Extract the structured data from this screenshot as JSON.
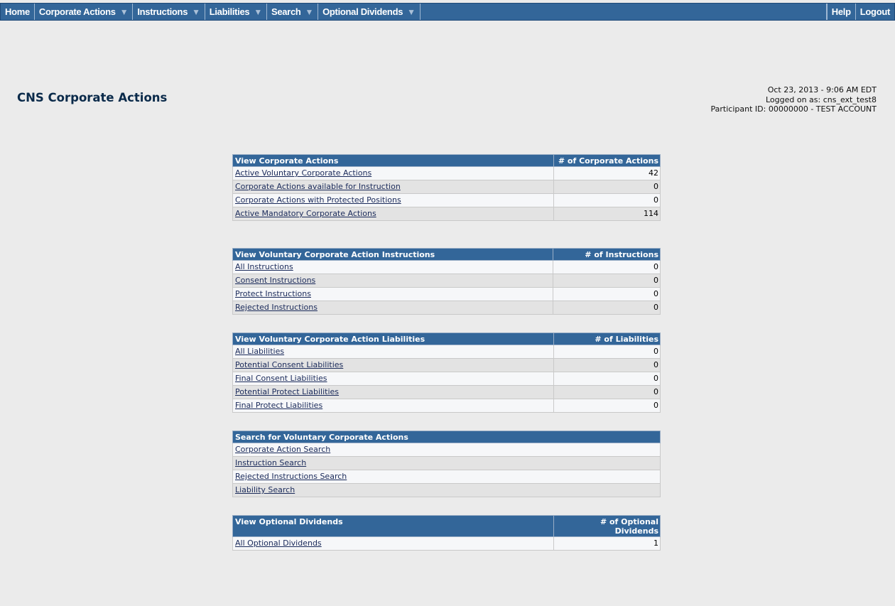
{
  "nav": {
    "left": [
      {
        "label": "Home",
        "dropdown": false
      },
      {
        "label": "Corporate Actions",
        "dropdown": true
      },
      {
        "label": "Instructions",
        "dropdown": true
      },
      {
        "label": "Liabilities",
        "dropdown": true
      },
      {
        "label": "Search",
        "dropdown": true
      },
      {
        "label": "Optional Dividends",
        "dropdown": true
      }
    ],
    "right": [
      {
        "label": "Help"
      },
      {
        "label": "Logout"
      }
    ],
    "arrow_glyph": "▼"
  },
  "page": {
    "title": "CNS Corporate Actions",
    "datetime": "Oct 23, 2013 - 9:06 AM EDT",
    "logged_on": "Logged on as: cns_ext_test8",
    "participant": "Participant ID: 00000000 - TEST ACCOUNT"
  },
  "tables": {
    "corporate_actions": {
      "header": "View Corporate Actions",
      "count_header": "# of Corporate Actions",
      "rows": [
        {
          "label": "Active Voluntary Corporate Actions",
          "count": "42"
        },
        {
          "label": "Corporate Actions available for Instruction",
          "count": "0"
        },
        {
          "label": "Corporate Actions with Protected Positions",
          "count": "0"
        },
        {
          "label": "Active Mandatory Corporate Actions",
          "count": "114"
        }
      ]
    },
    "instructions": {
      "header": "View Voluntary Corporate Action Instructions",
      "count_header": "# of Instructions",
      "rows": [
        {
          "label": "All Instructions",
          "count": "0"
        },
        {
          "label": "Consent Instructions",
          "count": "0"
        },
        {
          "label": "Protect Instructions",
          "count": "0"
        },
        {
          "label": "Rejected Instructions",
          "count": "0"
        }
      ]
    },
    "liabilities": {
      "header": "View Voluntary Corporate Action Liabilities",
      "count_header": "# of Liabilities",
      "rows": [
        {
          "label": "All Liabilities",
          "count": "0"
        },
        {
          "label": "Potential Consent Liabilities",
          "count": "0"
        },
        {
          "label": "Final Consent Liabilities",
          "count": "0"
        },
        {
          "label": "Potential Protect Liabilities",
          "count": "0"
        },
        {
          "label": "Final Protect Liabilities",
          "count": "0"
        }
      ]
    },
    "search": {
      "header": "Search for Voluntary Corporate Actions",
      "rows": [
        {
          "label": "Corporate Action Search"
        },
        {
          "label": "Instruction Search"
        },
        {
          "label": "Rejected Instructions Search"
        },
        {
          "label": "Liability Search"
        }
      ]
    },
    "dividends": {
      "header": "View Optional Dividends",
      "count_header": "# of Optional Dividends",
      "rows": [
        {
          "label": "All Optional Dividends",
          "count": "1"
        }
      ]
    }
  },
  "colors": {
    "nav_bg": "#336699",
    "header_bg": "#336699",
    "page_bg": "#ebebeb"
  }
}
